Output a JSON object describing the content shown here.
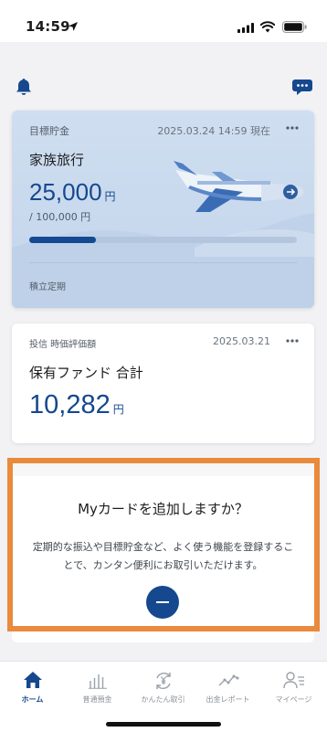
{
  "status_bar": {
    "time": "14:59"
  },
  "header": {
    "left_icon": "bell-icon",
    "right_icon": "chat-bubble-icon"
  },
  "goal_card": {
    "category": "目標貯金",
    "timestamp": "2025.03.24 14:59 現在",
    "title": "家族旅行",
    "amount": "25,000",
    "amount_unit": "円",
    "target": "/ 100,000 円",
    "progress": 0.25,
    "type": "積立定期"
  },
  "fund_card": {
    "category": "投信 時価評価額",
    "date": "2025.03.21",
    "title": "保有ファンド 合計",
    "amount": "10,282",
    "amount_unit": "円"
  },
  "add_card": {
    "title": "Myカードを追加しますか？",
    "description": "定期的な振込や目標貯金など、よく使う機能を登録することで、カンタン便利にお取引いただけます。"
  },
  "tabs": [
    {
      "label": "ホーム",
      "icon": "home-icon",
      "active": true
    },
    {
      "label": "普通預金",
      "icon": "bar-chart-icon",
      "active": false
    },
    {
      "label": "かんたん取引",
      "icon": "yen-refresh-icon",
      "active": false
    },
    {
      "label": "出金レポート",
      "icon": "line-chart-icon",
      "active": false
    },
    {
      "label": "マイページ",
      "icon": "user-list-icon",
      "active": false
    }
  ],
  "colors": {
    "brand_blue": "#15488f",
    "highlight_orange": "#e98a3c",
    "goal_card_bg": "#c9daee"
  }
}
